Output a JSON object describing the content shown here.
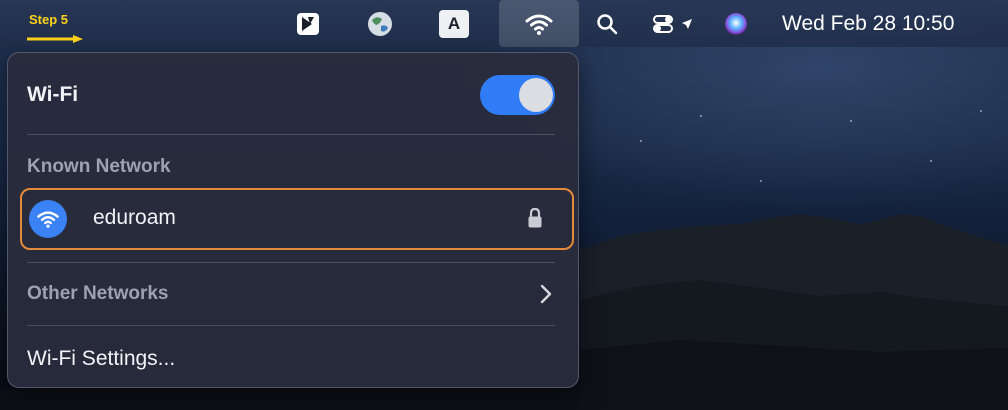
{
  "tutorial": {
    "step_label": "Step 5",
    "accent_color": "#ffd21a"
  },
  "menubar": {
    "icons": [
      "kapwing-icon",
      "globe-icon",
      "input-source-icon",
      "wifi-icon",
      "spotlight-search-icon",
      "control-center-icon",
      "location-arrow-icon",
      "siri-icon"
    ],
    "input_source_label": "A",
    "clock": "Wed Feb 28  10:50"
  },
  "wifi_panel": {
    "title": "Wi-Fi",
    "toggle_on": true,
    "toggle_color": "#2f7cf6",
    "known_label": "Known Network",
    "known_networks": [
      {
        "name": "eduroam",
        "secured": true,
        "highlight_color": "#e58a3a"
      }
    ],
    "other_label": "Other Networks",
    "settings_label": "Wi-Fi Settings..."
  }
}
